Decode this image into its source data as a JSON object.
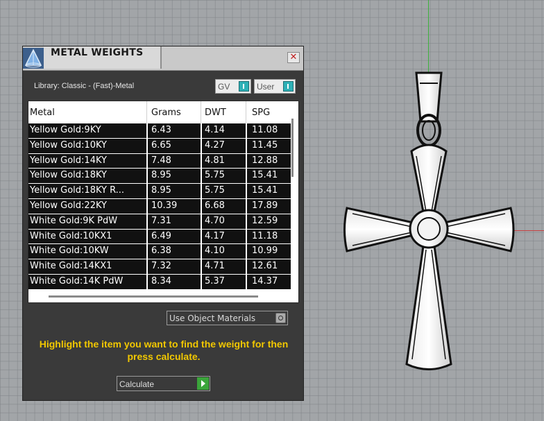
{
  "panel": {
    "title": "METAL WEIGHTS",
    "close_glyph": "✕",
    "library_label": "Library: Classic - (Fast)-Metal",
    "toggle_gv": "GV",
    "toggle_user": "User",
    "columns": [
      "Metal",
      "Grams",
      "DWT",
      "SPG"
    ],
    "rows": [
      {
        "metal": "Yellow Gold:9KY",
        "grams": "6.43",
        "dwt": "4.14",
        "spg": "11.08"
      },
      {
        "metal": "Yellow Gold:10KY",
        "grams": "6.65",
        "dwt": "4.27",
        "spg": "11.45"
      },
      {
        "metal": "Yellow Gold:14KY",
        "grams": "7.48",
        "dwt": "4.81",
        "spg": "12.88"
      },
      {
        "metal": "Yellow Gold:18KY",
        "grams": "8.95",
        "dwt": "5.75",
        "spg": "15.41"
      },
      {
        "metal": "Yellow Gold:18KY R...",
        "grams": "8.95",
        "dwt": "5.75",
        "spg": "15.41"
      },
      {
        "metal": "Yellow Gold:22KY",
        "grams": "10.39",
        "dwt": "6.68",
        "spg": "17.89"
      },
      {
        "metal": "White Gold:9K PdW",
        "grams": "7.31",
        "dwt": "4.70",
        "spg": "12.59"
      },
      {
        "metal": "White Gold:10KX1",
        "grams": "6.49",
        "dwt": "4.17",
        "spg": "11.18"
      },
      {
        "metal": "White Gold:10KW",
        "grams": "6.38",
        "dwt": "4.10",
        "spg": "10.99"
      },
      {
        "metal": "White Gold:14KX1",
        "grams": "7.32",
        "dwt": "4.71",
        "spg": "12.61"
      },
      {
        "metal": "White Gold:14K PdW",
        "grams": "8.34",
        "dwt": "5.37",
        "spg": "14.37"
      }
    ],
    "use_object_materials": "Use Object Materials",
    "instruction": "Highlight the item you want to find the weight for then press calculate.",
    "calculate_label": "Calculate"
  },
  "colors": {
    "accent_toggle": "#2eb0b6",
    "instruction_text": "#f2c800",
    "calculate_button": "#3aa53a",
    "viewport_bg": "#a2a5a8",
    "axis_green": "#3bb13b",
    "axis_red": "#c84242"
  },
  "icons": {
    "app_logo": "app-logo-icon",
    "close": "close-icon",
    "toggle_knob": "toggle-knob-icon",
    "play": "play-icon"
  }
}
